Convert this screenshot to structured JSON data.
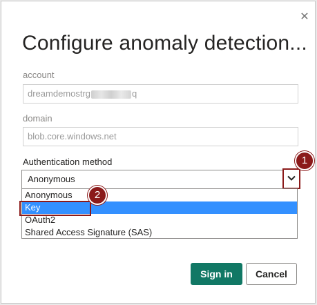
{
  "dialog": {
    "title": "Configure anomaly detection...",
    "close_icon": "✕"
  },
  "account": {
    "label": "account",
    "value_prefix": "dreamdemostrg",
    "value_suffix": "q"
  },
  "domain": {
    "label": "domain",
    "value": "blob.core.windows.net"
  },
  "auth": {
    "label": "Authentication method",
    "selected": "Anonymous",
    "options": [
      "Anonymous",
      "Key",
      "OAuth2",
      "Shared Access Signature (SAS)"
    ],
    "highlighted_option": "Key"
  },
  "annotations": {
    "badge1": "1",
    "badge2": "2",
    "color": "#8b1a1a"
  },
  "buttons": {
    "sign_in": "Sign in",
    "cancel": "Cancel"
  },
  "colors": {
    "primary": "#117865",
    "selection": "#3390ff"
  }
}
